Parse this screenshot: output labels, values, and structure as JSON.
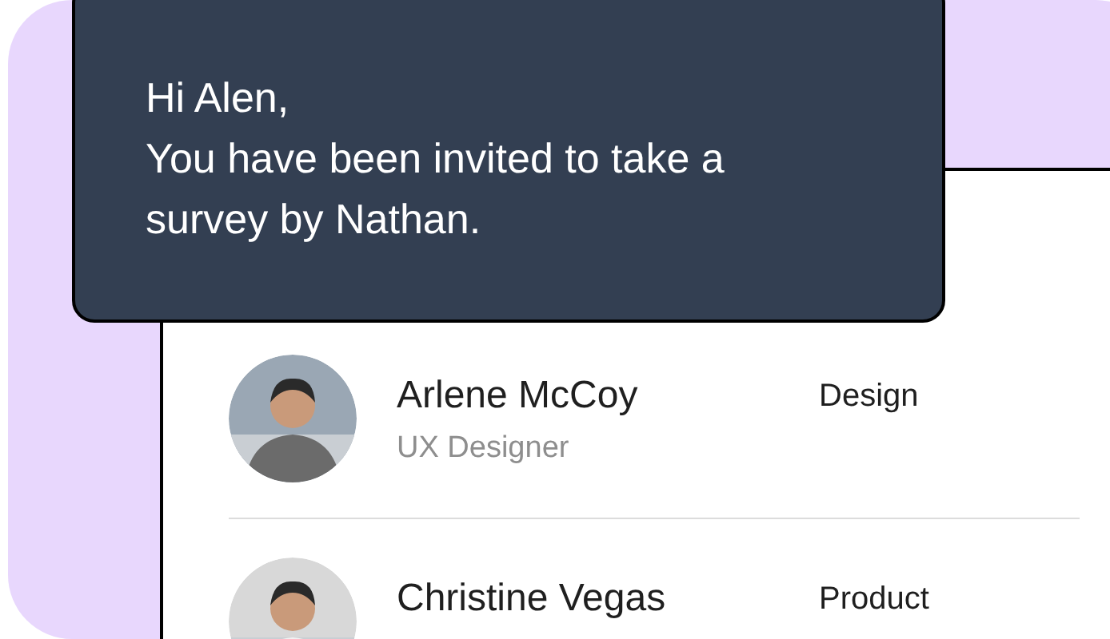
{
  "message": {
    "greeting": "Hi Alen,",
    "body": "You have been invited to take a survey by Nathan."
  },
  "people": [
    {
      "name": "Arlene McCoy",
      "role": "UX Designer",
      "department": "Design"
    },
    {
      "name": "Christine Vegas",
      "department": "Product"
    }
  ]
}
